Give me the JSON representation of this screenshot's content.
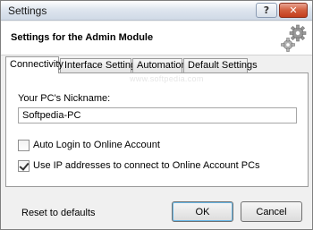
{
  "window": {
    "title": "Settings",
    "help_glyph": "?",
    "close_glyph": "✕"
  },
  "header": {
    "title": "Settings for the Admin Module",
    "icon": "gears-icon"
  },
  "tabs": [
    {
      "label": "Connectivity",
      "active": true
    },
    {
      "label": "Interface Settings",
      "active": false
    },
    {
      "label": "Automation",
      "active": false
    },
    {
      "label": "Default Settings",
      "active": false
    }
  ],
  "connectivity": {
    "watermark": "www.softpedia.com",
    "nickname_label": "Your PC's Nickname:",
    "nickname_value": "Softpedia-PC",
    "auto_login_label": "Auto Login to Online Account",
    "auto_login_checked": false,
    "use_ip_label": "Use IP addresses to connect to Online Account PCs",
    "use_ip_checked": true
  },
  "footer": {
    "reset_label": "Reset to defaults",
    "ok_label": "OK",
    "cancel_label": "Cancel"
  }
}
